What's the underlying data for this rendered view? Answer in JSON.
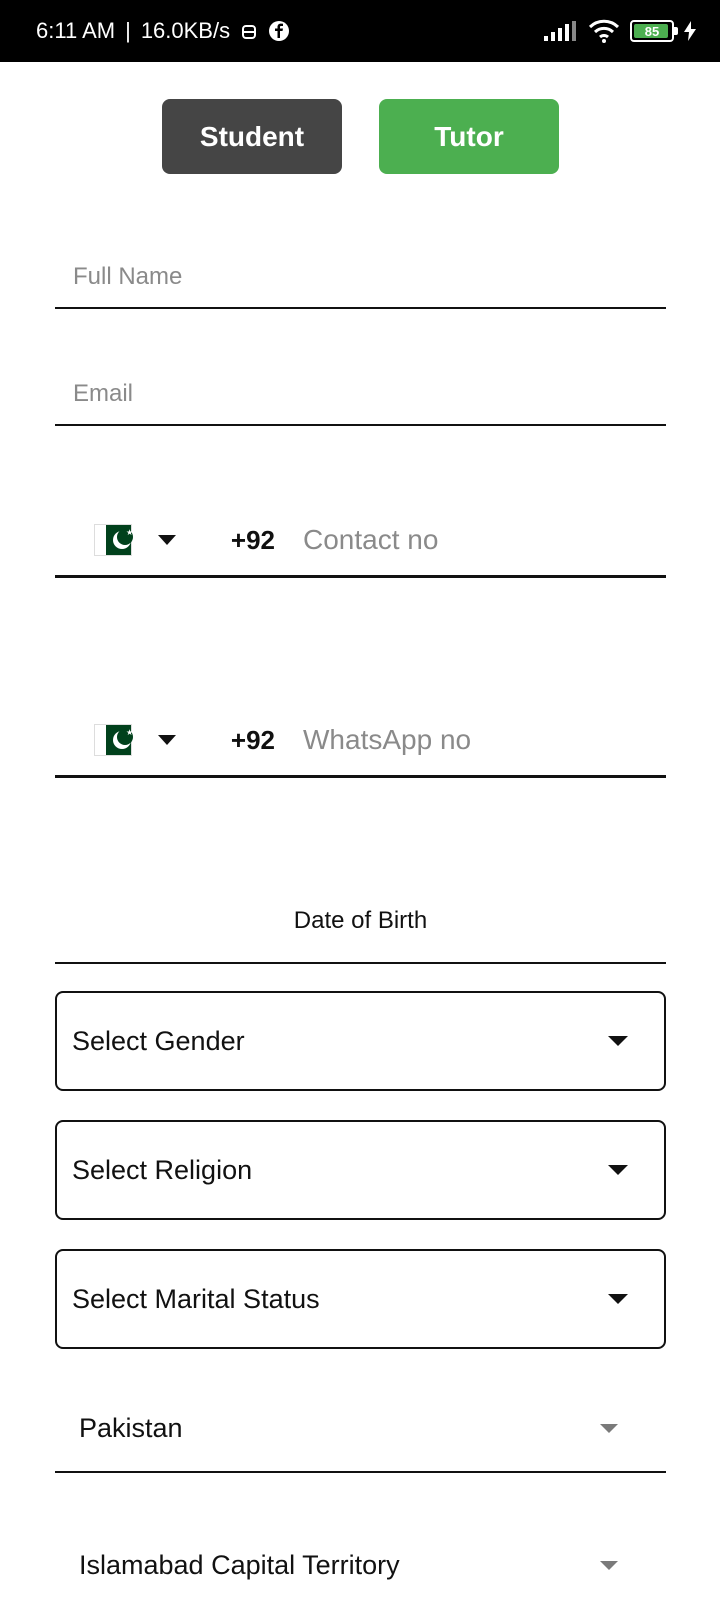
{
  "status_bar": {
    "time": "6:11 AM",
    "speed": "16.0KB/s",
    "battery": "85"
  },
  "roles": {
    "student": "Student",
    "tutor": "Tutor",
    "selected": "Tutor",
    "selected_color": "#4caf50",
    "unselected_color": "#454545"
  },
  "form": {
    "full_name": {
      "placeholder": "Full Name",
      "value": ""
    },
    "email": {
      "placeholder": "Email",
      "value": ""
    },
    "contact": {
      "dial_code": "+92",
      "placeholder": "Contact no",
      "country_flag": "pakistan-flag-icon"
    },
    "whatsapp": {
      "dial_code": "+92",
      "placeholder": "WhatsApp no",
      "country_flag": "pakistan-flag-icon"
    },
    "dob_label": "Date of Birth",
    "gender": "Select Gender",
    "religion": "Select Religion",
    "marital_status": "Select Marital Status",
    "country": "Pakistan",
    "province": "Islamabad Capital Territory"
  }
}
